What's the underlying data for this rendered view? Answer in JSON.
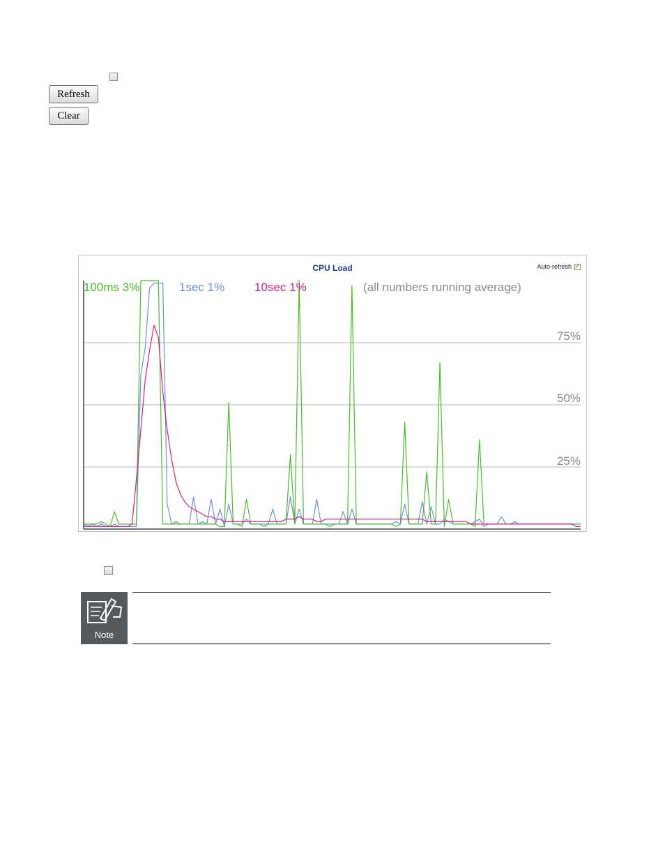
{
  "controls": {
    "auto_refresh_checked": false,
    "refresh_label": "Refresh",
    "clear_label": "Clear"
  },
  "bottom_checkbox_checked": false,
  "note": {
    "icon": "note-pencil-icon",
    "label": "Note"
  },
  "chart_data": {
    "type": "line",
    "title": "CPU Load",
    "auto_refresh_label": "Auto-refresh",
    "auto_refresh_checked": true,
    "ylim": [
      0,
      100
    ],
    "grid": true,
    "gridlines": [
      25,
      50,
      75
    ],
    "y_tick_labels": [
      "25%",
      "50%",
      "75%"
    ],
    "annotation": "(all numbers running average)",
    "series": [
      {
        "name": "100ms",
        "current": "3%",
        "color": "#4cb82e",
        "values": [
          2,
          2,
          2,
          2,
          3,
          2,
          1,
          7,
          2,
          2,
          2,
          2,
          2,
          100,
          100,
          100,
          100,
          100,
          2,
          2,
          2,
          2,
          2,
          2,
          2,
          2,
          2,
          2,
          2,
          2,
          2,
          1,
          1,
          51,
          2,
          2,
          1,
          12,
          2,
          2,
          2,
          1,
          2,
          2,
          2,
          2,
          2,
          30,
          2,
          100,
          2,
          2,
          2,
          2,
          2,
          2,
          1,
          2,
          2,
          2,
          2,
          98,
          2,
          2,
          2,
          2,
          2,
          2,
          2,
          2,
          2,
          1,
          2,
          43,
          2,
          2,
          2,
          2,
          23,
          2,
          2,
          67,
          1,
          12,
          2,
          2,
          2,
          2,
          2,
          1,
          36,
          2,
          2,
          2,
          2,
          2,
          2,
          2,
          2,
          2,
          2,
          2,
          2,
          2,
          2,
          2,
          2,
          2,
          2,
          2,
          2,
          2,
          2,
          2
        ]
      },
      {
        "name": "1sec",
        "current": "1%",
        "color": "#6f8fd9",
        "values": [
          2,
          1,
          2,
          1,
          2,
          1,
          1,
          2,
          1,
          1,
          1,
          1,
          1,
          62,
          73,
          97,
          99,
          99,
          99,
          10,
          2,
          3,
          2,
          2,
          2,
          13,
          2,
          3,
          2,
          12,
          2,
          8,
          1,
          10,
          2,
          2,
          2,
          4,
          2,
          2,
          2,
          2,
          2,
          8,
          2,
          2,
          2,
          13,
          2,
          8,
          2,
          2,
          2,
          12,
          2,
          2,
          2,
          2,
          2,
          7,
          2,
          8,
          2,
          2,
          2,
          2,
          2,
          2,
          2,
          2,
          2,
          3,
          2,
          10,
          2,
          2,
          2,
          11,
          2,
          9,
          2,
          2,
          4,
          3,
          2,
          2,
          2,
          2,
          2,
          3,
          4,
          1,
          2,
          2,
          2,
          5,
          2,
          2,
          3,
          2,
          2,
          2,
          2,
          2,
          2,
          2,
          2,
          2,
          2,
          2,
          2,
          2,
          2,
          2
        ]
      },
      {
        "name": "10sec",
        "current": "1%",
        "color": "#d0218a",
        "values": [
          1,
          1,
          1,
          1,
          1,
          1,
          1,
          1,
          1,
          1,
          1,
          2,
          20,
          40,
          60,
          72,
          82,
          77,
          55,
          40,
          28,
          19,
          14,
          11,
          9,
          8,
          7,
          6,
          5,
          5,
          4,
          4,
          3,
          3,
          3,
          3,
          3,
          3,
          3,
          3,
          3,
          3,
          3,
          3,
          3,
          3,
          4,
          4,
          4,
          5,
          4,
          4,
          4,
          3,
          3,
          4,
          4,
          4,
          4,
          4,
          4,
          4,
          4,
          4,
          4,
          4,
          4,
          4,
          4,
          4,
          4,
          4,
          4,
          4,
          4,
          4,
          4,
          4,
          3,
          3,
          3,
          3,
          3,
          3,
          3,
          3,
          3,
          3,
          2,
          2,
          2,
          2,
          2,
          2,
          2,
          2,
          2,
          2,
          2,
          2,
          2,
          2,
          2,
          2,
          2,
          2,
          2,
          2,
          2,
          2,
          2,
          2,
          1,
          1
        ]
      }
    ]
  }
}
